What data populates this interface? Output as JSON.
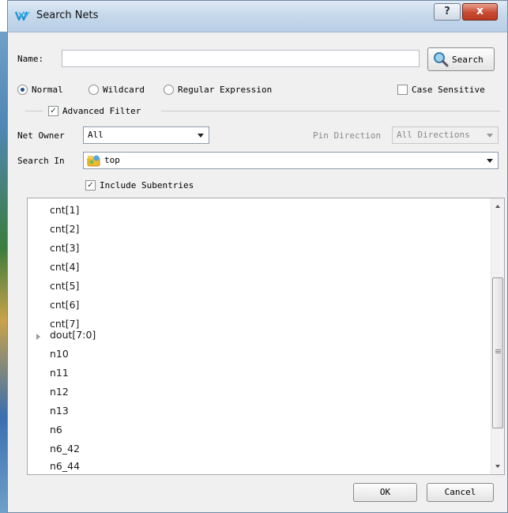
{
  "window": {
    "title": "Search Nets"
  },
  "titlebar": {
    "help_label": "?",
    "close_label": "x"
  },
  "name_field": {
    "label": "Name:",
    "value": "",
    "placeholder": ""
  },
  "search_button": {
    "label": "Search"
  },
  "match_mode": {
    "options": [
      "Normal",
      "Wildcard",
      "Regular Expression"
    ],
    "selected": "Normal"
  },
  "case_sensitive": {
    "label": "Case Sensitive",
    "checked": false
  },
  "advanced_filter": {
    "label": "Advanced Filter",
    "checked": true
  },
  "net_owner": {
    "label": "Net Owner",
    "value": "All"
  },
  "pin_direction": {
    "label": "Pin Direction",
    "value": "All Directions",
    "enabled": false
  },
  "search_in": {
    "label": "Search In",
    "value": "top"
  },
  "include_subentries": {
    "label": "Include Subentries",
    "checked": true
  },
  "results": [
    {
      "name": "cnt[1]",
      "expandable": false
    },
    {
      "name": "cnt[2]",
      "expandable": false
    },
    {
      "name": "cnt[3]",
      "expandable": false
    },
    {
      "name": "cnt[4]",
      "expandable": false
    },
    {
      "name": "cnt[5]",
      "expandable": false
    },
    {
      "name": "cnt[6]",
      "expandable": false
    },
    {
      "name": "cnt[7]",
      "expandable": false
    },
    {
      "name": "dout[7:0]",
      "expandable": true
    },
    {
      "name": "n10",
      "expandable": false
    },
    {
      "name": "n11",
      "expandable": false
    },
    {
      "name": "n12",
      "expandable": false
    },
    {
      "name": "n13",
      "expandable": false
    },
    {
      "name": "n6",
      "expandable": false
    },
    {
      "name": "n6_42",
      "expandable": false
    },
    {
      "name": "n6_44",
      "expandable": false
    }
  ],
  "buttons": {
    "ok": "OK",
    "cancel": "Cancel"
  },
  "icons": {
    "app": "gowin-logo-icon",
    "search": "magnifier-icon",
    "module": "module-folder-icon"
  },
  "colors": {
    "titlebar": "#c6d9ec",
    "close": "#c74a32",
    "background": "#f0f0f0"
  }
}
